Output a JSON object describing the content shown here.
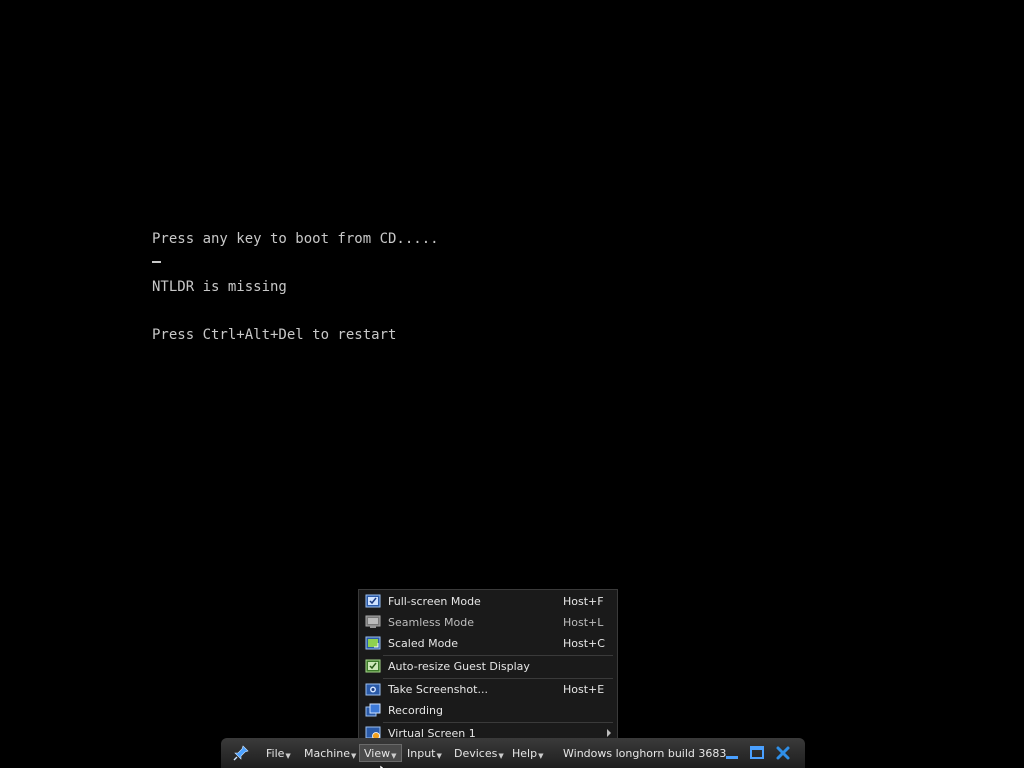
{
  "console": {
    "lines": [
      "Press any key to boot from CD.....",
      "NTLDR is missing",
      "Press Ctrl+Alt+Del to restart"
    ],
    "cursor": "_"
  },
  "view_menu": {
    "items": [
      {
        "label": "Full-screen Mode",
        "shortcut": "Host+F",
        "icon": "fullscreen-icon"
      },
      {
        "label": "Seamless Mode",
        "shortcut": "Host+L",
        "icon": "seamless-icon"
      },
      {
        "label": "Scaled Mode",
        "shortcut": "Host+C",
        "icon": "scaled-icon"
      },
      {
        "label": "Auto-resize Guest Display",
        "shortcut": "",
        "icon": "auto-resize-icon"
      },
      {
        "label": "Take Screenshot...",
        "shortcut": "Host+E",
        "icon": "screenshot-icon"
      },
      {
        "label": "Recording",
        "shortcut": "",
        "icon": "recording-icon"
      },
      {
        "label": "Virtual Screen 1",
        "shortcut": "",
        "icon": "virtual-screen-icon"
      }
    ]
  },
  "toolbar": {
    "menus": [
      "File",
      "Machine",
      "View",
      "Input",
      "Devices",
      "Help"
    ],
    "active_menu": "View",
    "vm_title": "Windows longhorn build 3683"
  },
  "colors": {
    "console_text": "#c8c8c8",
    "close_button": "#2f8fe8",
    "toolbar_bg": "#2a2a2a"
  }
}
